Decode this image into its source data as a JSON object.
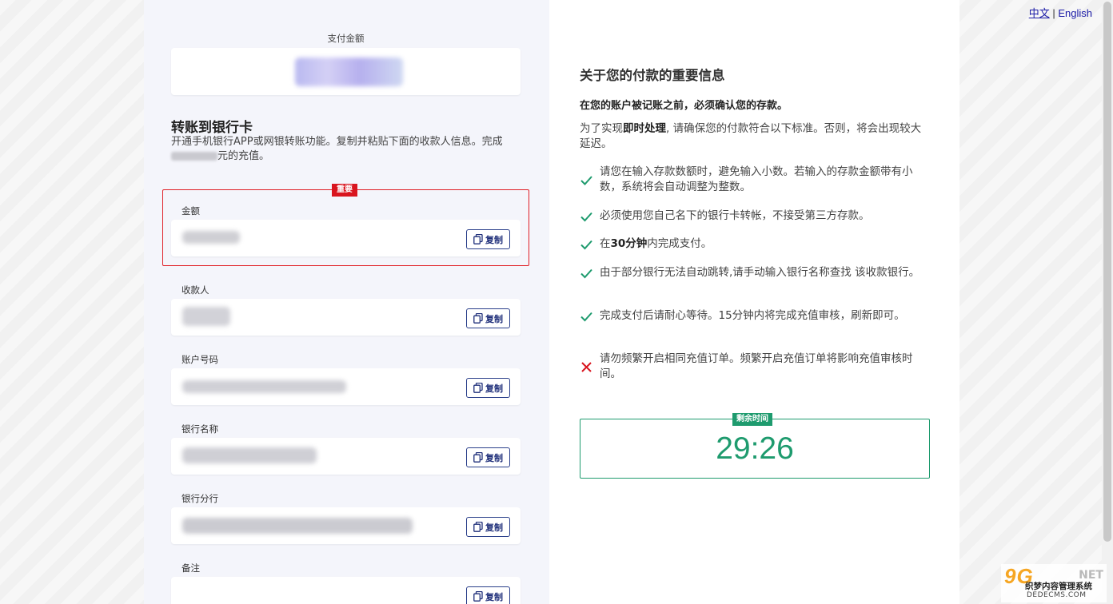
{
  "lang_switch": {
    "zh": "中文",
    "sep": "|",
    "en": "English"
  },
  "payment": {
    "amount_label": "支付金额"
  },
  "transfer": {
    "title": "转账到银行卡",
    "desc_part1": "开通手机银行APP或网银转账功能。复制并粘贴下面的收款人信息。完成",
    "desc_part2": "元的充值。"
  },
  "important_badge": "重要",
  "fields": [
    {
      "label": "金额",
      "copy": "复制"
    },
    {
      "label": "收款人",
      "copy": "复制"
    },
    {
      "label": "账户号码",
      "copy": "复制"
    },
    {
      "label": "银行名称",
      "copy": "复制"
    },
    {
      "label": "银行分行",
      "copy": "复制"
    },
    {
      "label": "备注",
      "copy": "复制"
    }
  ],
  "info": {
    "title": "关于您的付款的重要信息",
    "bold_line": "在您的账户被记账之前，必须确认您的存款。",
    "para_a": "为了实现",
    "para_b": "即时处理",
    "para_c": ", 请确保您的付款符合以下标准。否则，将会出现较大延迟。",
    "rules": [
      {
        "icon": "check-icon",
        "text": "请您在输入存款数额时，避免输入小数。若输入的存款金额带有小数，系统将会自动调整为整数。"
      },
      {
        "icon": "check-icon",
        "text": "必须使用您自己名下的银行卡转帐，不接受第三方存款。"
      },
      {
        "icon": "check-icon",
        "pre": "在",
        "bold": "30分钟",
        "post": "内完成支付。"
      },
      {
        "icon": "check-icon",
        "text": "由于部分银行无法自动跳转,请手动输入银行名称查找 该收款银行。"
      },
      {
        "icon": "check-icon",
        "text": "完成支付后请耐心等待。15分钟内将完成充值审核，刷新即可。"
      },
      {
        "icon": "cross-icon",
        "text": "请勿频繁开启相同充值订单。频繁开启充值订单将影响充值审核时间。"
      }
    ]
  },
  "timer": {
    "badge": "剩余时间",
    "value": "29:26"
  },
  "colors": {
    "check": "#1e9b6e",
    "cross": "#d9151f",
    "accent_red": "#e01f26",
    "copy_btn": "#1f2f7a"
  },
  "watermark": {
    "logo": "9G",
    "net": "NET",
    "cn": "织梦内容管理系统",
    "domain": "DEDECMS.COM"
  }
}
